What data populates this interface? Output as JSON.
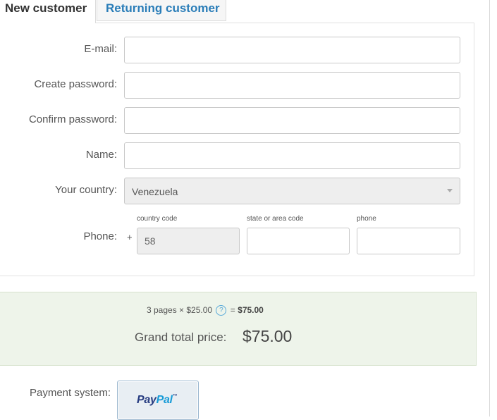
{
  "tabs": {
    "new_customer": "New customer",
    "returning_customer": "Returning customer"
  },
  "form": {
    "email_label": "E-mail:",
    "email_value": "",
    "create_password_label": "Create password:",
    "create_password_value": "",
    "confirm_password_label": "Confirm password:",
    "confirm_password_value": "",
    "name_label": "Name:",
    "name_value": "",
    "country_label": "Your country:",
    "country_value": "Venezuela",
    "phone_label": "Phone:",
    "phone_plus": "+",
    "country_code_label": "country code",
    "country_code_value": "58",
    "area_code_label": "state or area code",
    "area_code_value": "",
    "phone_number_label": "phone",
    "phone_number_value": ""
  },
  "price": {
    "pages_calc": "3 pages × $25.00",
    "help_glyph": "?",
    "equals": "=",
    "subtotal": "$75.00",
    "grand_total_label": "Grand total price:",
    "grand_total_value": "$75.00"
  },
  "payment": {
    "label": "Payment system:",
    "paypal_part1": "Pay",
    "paypal_part2": "Pal",
    "paypal_tm": "™"
  },
  "colors": {
    "tab_active_text": "#333333",
    "tab_link_text": "#2a7db8",
    "price_box_bg": "#eef4ea",
    "paypal_dark": "#253b80",
    "paypal_light": "#179bd7"
  }
}
